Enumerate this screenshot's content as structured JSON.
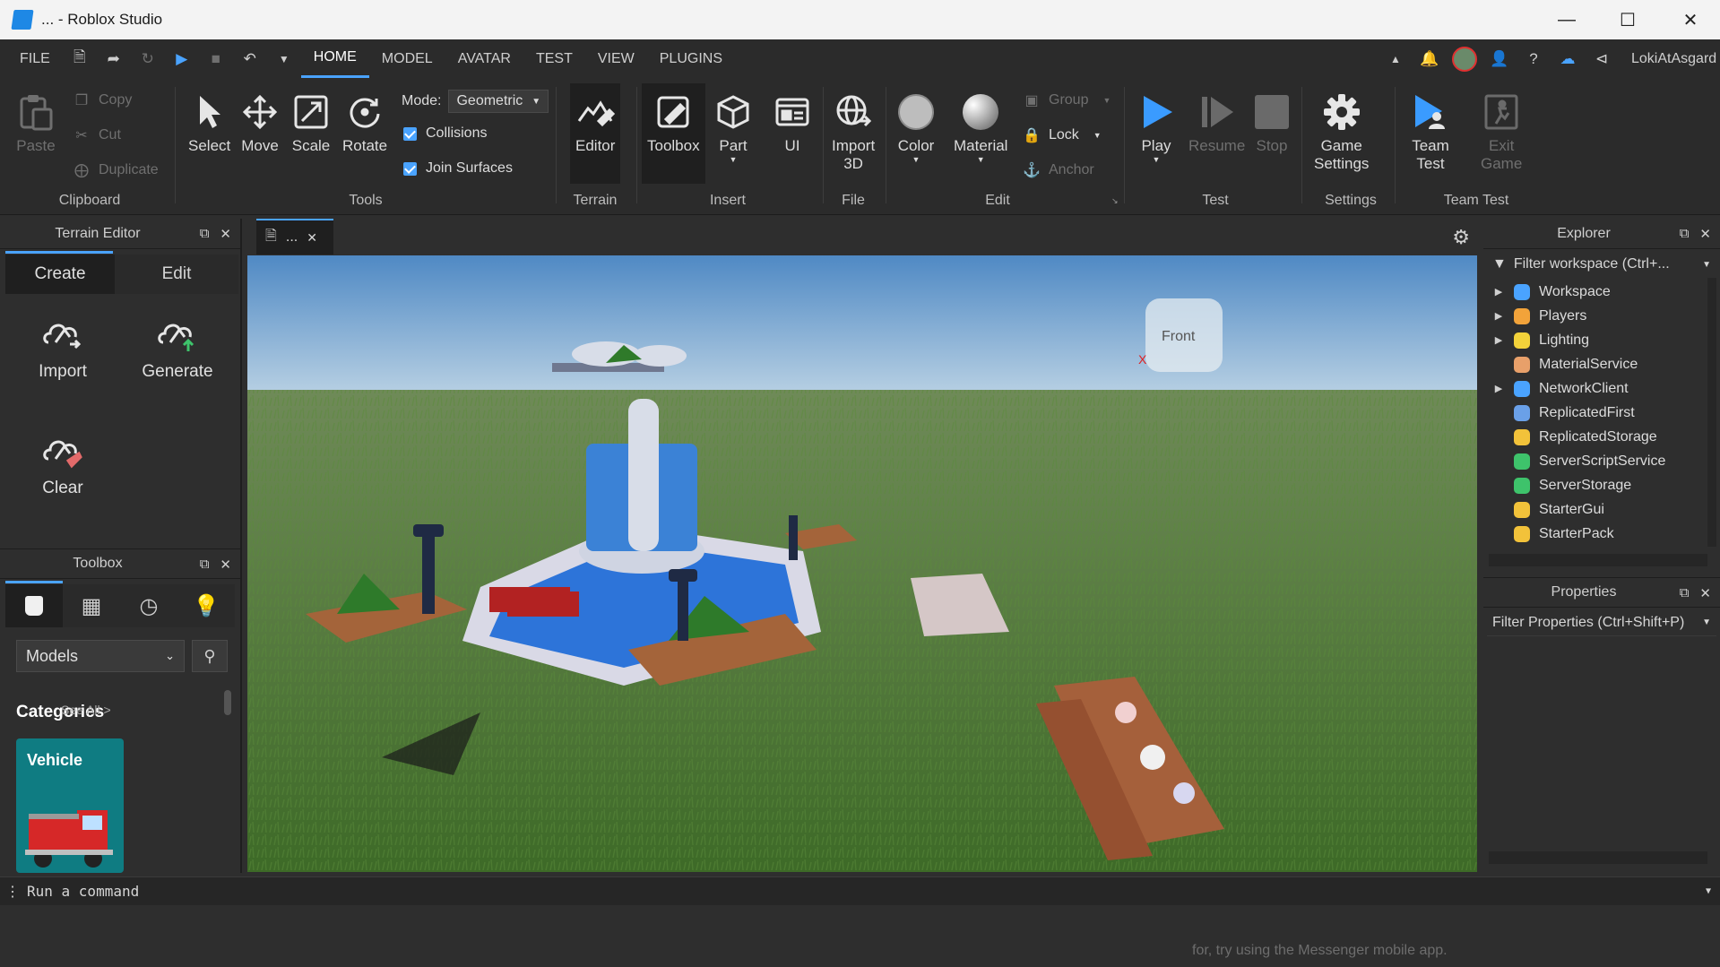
{
  "window": {
    "title": "... - Roblox Studio"
  },
  "menu": {
    "file": "FILE",
    "tabs": [
      "HOME",
      "MODEL",
      "AVATAR",
      "TEST",
      "VIEW",
      "PLUGINS"
    ],
    "user": "LokiAtAsgard"
  },
  "ribbon": {
    "clipboard": {
      "paste": "Paste",
      "copy": "Copy",
      "cut": "Cut",
      "duplicate": "Duplicate",
      "label": "Clipboard"
    },
    "tools": {
      "select": "Select",
      "move": "Move",
      "scale": "Scale",
      "rotate": "Rotate",
      "mode_label": "Mode:",
      "mode_value": "Geometric",
      "collisions": "Collisions",
      "join_surfaces": "Join Surfaces",
      "label": "Tools"
    },
    "terrain": {
      "editor": "Editor",
      "label": "Terrain"
    },
    "insert": {
      "toolbox": "Toolbox",
      "part": "Part",
      "ui": "UI",
      "label": "Insert"
    },
    "file": {
      "import3d_line1": "Import",
      "import3d_line2": "3D",
      "label": "File"
    },
    "edit": {
      "color": "Color",
      "material": "Material",
      "group": "Group",
      "lock": "Lock",
      "anchor": "Anchor",
      "label": "Edit"
    },
    "test": {
      "play": "Play",
      "resume": "Resume",
      "stop": "Stop",
      "label": "Test"
    },
    "settings": {
      "game_settings_line1": "Game",
      "game_settings_line2": "Settings",
      "label": "Settings"
    },
    "team_test": {
      "team_test_line1": "Team",
      "team_test_line2": "Test",
      "exit_game_line1": "Exit",
      "exit_game_line2": "Game",
      "label": "Team Test"
    }
  },
  "terrain_editor": {
    "title": "Terrain Editor",
    "tabs": [
      "Create",
      "Edit"
    ],
    "tools": [
      "Import",
      "Generate",
      "Clear"
    ]
  },
  "toolbox": {
    "title": "Toolbox",
    "dropdown": "Models",
    "categories_label": "Categories",
    "see_all": "See All >",
    "card": "Vehicle"
  },
  "viewport": {
    "tab": "...",
    "view_cube": "Front"
  },
  "explorer": {
    "title": "Explorer",
    "filter_placeholder": "Filter workspace (Ctrl+...",
    "items": [
      {
        "name": "Workspace",
        "expandable": true
      },
      {
        "name": "Players",
        "expandable": true
      },
      {
        "name": "Lighting",
        "expandable": true
      },
      {
        "name": "MaterialService",
        "expandable": false
      },
      {
        "name": "NetworkClient",
        "expandable": true
      },
      {
        "name": "ReplicatedFirst",
        "expandable": false
      },
      {
        "name": "ReplicatedStorage",
        "expandable": false
      },
      {
        "name": "ServerScriptService",
        "expandable": false
      },
      {
        "name": "ServerStorage",
        "expandable": false
      },
      {
        "name": "StarterGui",
        "expandable": false
      },
      {
        "name": "StarterPack",
        "expandable": false
      }
    ]
  },
  "properties": {
    "title": "Properties",
    "filter_placeholder": "Filter Properties (Ctrl+Shift+P)"
  },
  "command_bar": {
    "placeholder": "Run a command"
  },
  "bottom_notice": "for, try using the Messenger mobile app."
}
